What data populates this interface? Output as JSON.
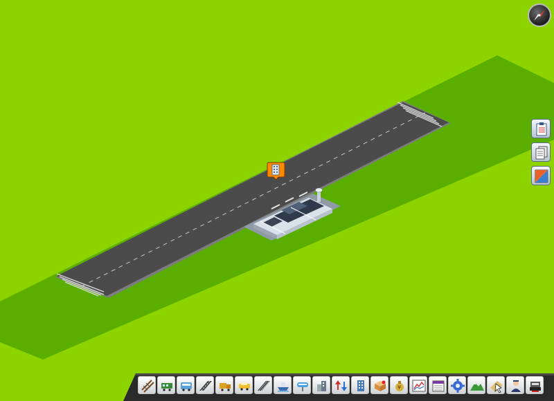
{
  "colors": {
    "grass_light": "#8dd300",
    "grass_dark": "#5aae00",
    "runway": "#4a4a4a",
    "runway_edge": "#7a7a7a",
    "marker_orange": "#ff8a00",
    "toolbar_bg": "#2a2a2a"
  },
  "map": {
    "structure": "airport-terminal",
    "facility": "runway"
  },
  "compass": {
    "icon": "compass-icon"
  },
  "side_panel": [
    {
      "id": "schedule",
      "icon": "clipboard-icon"
    },
    {
      "id": "reports",
      "icon": "documents-icon"
    },
    {
      "id": "route",
      "icon": "route-icon"
    }
  ],
  "toolbar": [
    {
      "id": "rail",
      "icon": "railroad-track-icon"
    },
    {
      "id": "train",
      "icon": "train-icon"
    },
    {
      "id": "bus",
      "icon": "bus-icon"
    },
    {
      "id": "road",
      "icon": "road-icon"
    },
    {
      "id": "truck",
      "icon": "truck-icon"
    },
    {
      "id": "vehicle",
      "icon": "vehicle-icon"
    },
    {
      "id": "highway",
      "icon": "highway-icon"
    },
    {
      "id": "ship",
      "icon": "ship-icon"
    },
    {
      "id": "monorail",
      "icon": "monorail-icon"
    },
    {
      "id": "buildings",
      "icon": "buildings-icon"
    },
    {
      "id": "terrain",
      "icon": "raise-lower-icon"
    },
    {
      "id": "tower",
      "icon": "tower-icon"
    },
    {
      "id": "cargo",
      "icon": "cargo-box-icon"
    },
    {
      "id": "finance",
      "icon": "money-bag-icon"
    },
    {
      "id": "graphs",
      "icon": "graph-icon"
    },
    {
      "id": "calendar",
      "icon": "calendar-icon"
    },
    {
      "id": "settings",
      "icon": "gear-icon"
    },
    {
      "id": "landscape",
      "icon": "mountain-icon"
    },
    {
      "id": "pointer",
      "icon": "cursor-icon"
    },
    {
      "id": "advisor",
      "icon": "advisor-icon"
    },
    {
      "id": "demolish",
      "icon": "bulldozer-icon"
    }
  ]
}
